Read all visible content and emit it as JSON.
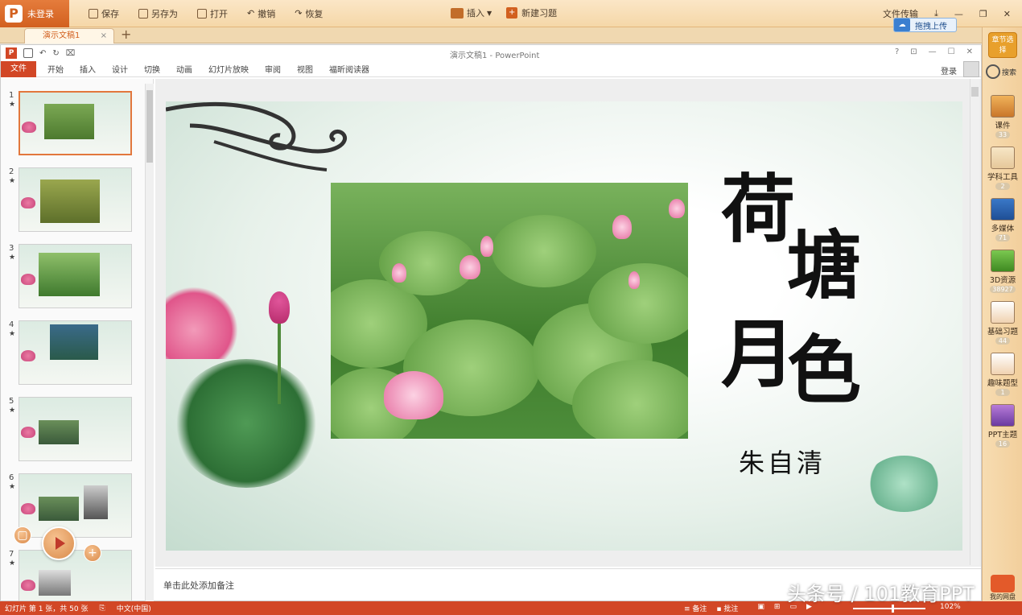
{
  "topbar": {
    "login": "未登录",
    "save": "保存",
    "save_as": "另存为",
    "open": "打开",
    "undo": "撤销",
    "redo": "恢复",
    "insert": "插入",
    "new_exercise": "新建习题",
    "file_transfer": "文件传输",
    "drag_upload": "拖拽上传"
  },
  "tabs": {
    "doc_tab": "演示文稿1"
  },
  "window": {
    "title": "演示文稿1 - PowerPoint",
    "pp_icon": "P",
    "help": "?",
    "ribbon": [
      "文件",
      "开始",
      "插入",
      "设计",
      "切换",
      "动画",
      "幻灯片放映",
      "审阅",
      "视图",
      "福昕阅读器"
    ],
    "login": "登录"
  },
  "thumbnails": [
    {
      "num": "1",
      "star": "★"
    },
    {
      "num": "2",
      "star": "★"
    },
    {
      "num": "3",
      "star": "★"
    },
    {
      "num": "4",
      "star": "★"
    },
    {
      "num": "5",
      "star": "★"
    },
    {
      "num": "6",
      "star": "★"
    },
    {
      "num": "7",
      "star": "★"
    }
  ],
  "slide": {
    "title_chars": [
      "荷",
      "塘",
      "月",
      "色"
    ],
    "author": "朱自清"
  },
  "notes_placeholder": "单击此处添加备注",
  "statusbar": {
    "slide_info": "幻灯片 第 1 张，共 50 张",
    "language": "中文(中国)",
    "notes": "备注",
    "comments": "批注",
    "zoom": "102%"
  },
  "sidebar": {
    "top": "章节选择",
    "search": "搜索",
    "items": [
      {
        "label": "课件",
        "count": "33"
      },
      {
        "label": "学科工具",
        "count": "2"
      },
      {
        "label": "多媒体",
        "count": "71"
      },
      {
        "label": "3D资源",
        "count": "38927"
      },
      {
        "label": "基础习题",
        "count": "44"
      },
      {
        "label": "趣味题型",
        "count": "1"
      },
      {
        "label": "PPT主题",
        "count": "16"
      }
    ],
    "bottom": "我的网盘"
  },
  "watermark": "头条号 / 101教育PPT",
  "colors": {
    "accent": "#d24726",
    "topbar": "#f5d7a8"
  }
}
